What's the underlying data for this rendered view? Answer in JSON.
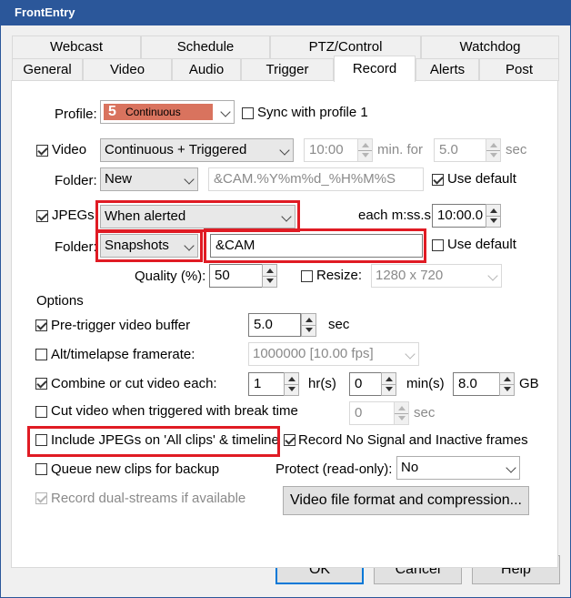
{
  "window": {
    "title": "FrontEntry"
  },
  "tabs_back": [
    "Webcast",
    "Schedule",
    "PTZ/Control",
    "Watchdog"
  ],
  "tabs_front": [
    "General",
    "Video",
    "Audio",
    "Trigger",
    "Record",
    "Alerts",
    "Post"
  ],
  "active_tab": "Record",
  "profile": {
    "label": "Profile:",
    "number": "5",
    "value": "Continuous",
    "chip_color": "#d9735e",
    "sync_label": "Sync with profile 1",
    "sync_checked": false
  },
  "video": {
    "label": "Video",
    "checked": true,
    "mode": "Continuous + Triggered",
    "time": "10:00",
    "min_for_label": "min. for",
    "sec_value": "5.0",
    "sec_label": "sec",
    "folder_label": "Folder:",
    "folder": "New",
    "path": "&CAM.%Y%m%d_%H%M%S",
    "use_default_label": "Use default",
    "use_default_checked": true
  },
  "jpegs": {
    "label": "JPEGs",
    "checked": true,
    "mode": "When alerted",
    "each_label": "each m:ss.s",
    "each_value": "10:00.0",
    "folder_label": "Folder:",
    "folder": "Snapshots",
    "path": "&CAM",
    "use_default_label": "Use default",
    "use_default_checked": false,
    "quality_label": "Quality (%):",
    "quality_value": "50",
    "resize_label": "Resize:",
    "resize_checked": false,
    "resize_value": "1280 x 720"
  },
  "options": {
    "group_label": "Options",
    "pretrigger_label": "Pre-trigger video buffer",
    "pretrigger_checked": true,
    "pretrigger_value": "5.0",
    "pretrigger_unit": "sec",
    "alt_label": "Alt/timelapse framerate:",
    "alt_checked": false,
    "alt_value": "1000000 [10.00 fps]",
    "combine_label": "Combine or cut video each:",
    "combine_checked": true,
    "combine_hr": "1",
    "hr_label": "hr(s)",
    "combine_min": "0",
    "min_label": "min(s)",
    "combine_gb": "8.0",
    "gb_label": "GB",
    "cut_label": "Cut video when triggered with break time",
    "cut_checked": false,
    "cut_value": "0",
    "cut_unit": "sec",
    "include_jpegs_label": "Include JPEGs on 'All clips' & timeline",
    "include_jpegs_checked": false,
    "no_signal_label": "Record No Signal and Inactive frames",
    "no_signal_checked": true,
    "queue_label": "Queue new clips for backup",
    "queue_checked": false,
    "protect_label": "Protect (read-only):",
    "protect_value": "No",
    "dual_label": "Record dual-streams if available",
    "dual_checked": true,
    "video_format_button": "Video file format and compression..."
  },
  "buttons": {
    "ok": "OK",
    "cancel": "Cancel",
    "help": "Help"
  },
  "colors": {
    "titlebar": "#2b579a",
    "highlight": "#e01b24",
    "default_button_border": "#0078d7"
  }
}
